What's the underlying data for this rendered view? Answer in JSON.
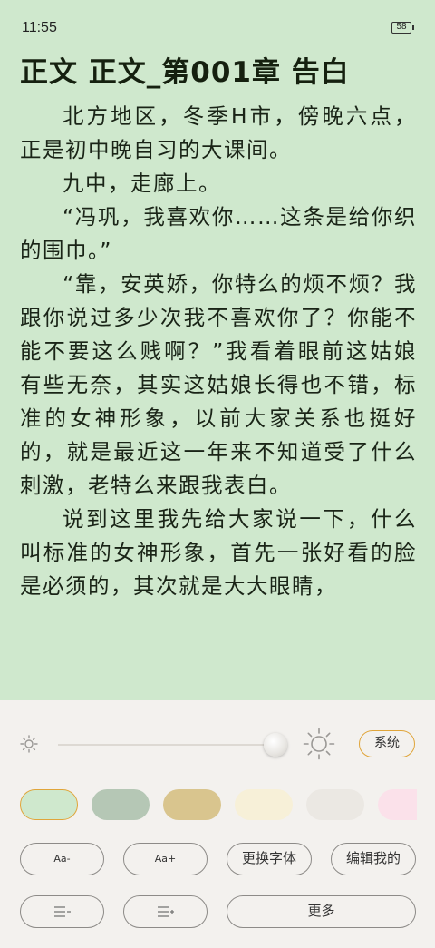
{
  "status": {
    "time": "11:55",
    "battery": "58"
  },
  "chapter": {
    "title": "正文 正文_第001章 告白"
  },
  "paragraphs": [
    "北方地区，冬季H市，傍晚六点，正是初中晚自习的大课间。",
    "九中，走廊上。",
    "“冯巩，我喜欢你……这条是给你织的围巾。”",
    "“靠，安英娇，你特么的烦不烦？我跟你说过多少次我不喜欢你了？你能不能不要这么贱啊？”我看着眼前这姑娘有些无奈，其实这姑娘长得也不错，标准的女神形象，以前大家关系也挺好的，就是最近这一年来不知道受了什么刺激，老特么来跟我表白。",
    "说到这里我先给大家说一下，什么叫标准的女神形象，首先一张好看的脸是必须的，其次就是大大眼睛，"
  ],
  "panel": {
    "brightness_level": 0.96,
    "system_label": "系统",
    "themes": [
      {
        "name": "light-green",
        "color": "#cfe8cd",
        "selected": true
      },
      {
        "name": "gray-green",
        "color": "#b5c7b5",
        "selected": false
      },
      {
        "name": "khaki",
        "color": "#d9c58e",
        "selected": false
      },
      {
        "name": "cream",
        "color": "#f7f0d8",
        "selected": false
      },
      {
        "name": "light-gray",
        "color": "#ebe8e3",
        "selected": false
      },
      {
        "name": "pink",
        "color": "#fbe1ea",
        "selected": false
      }
    ],
    "font_decrease_label": "Aa-",
    "font_increase_label": "Aa+",
    "change_font_label": "更换字体",
    "edit_mine_label": "编辑我的",
    "more_label": "更多"
  },
  "colors": {
    "accent": "#e0a53a",
    "reader_bg": "#cfe8cd",
    "panel_bg": "#f3f1ee"
  }
}
